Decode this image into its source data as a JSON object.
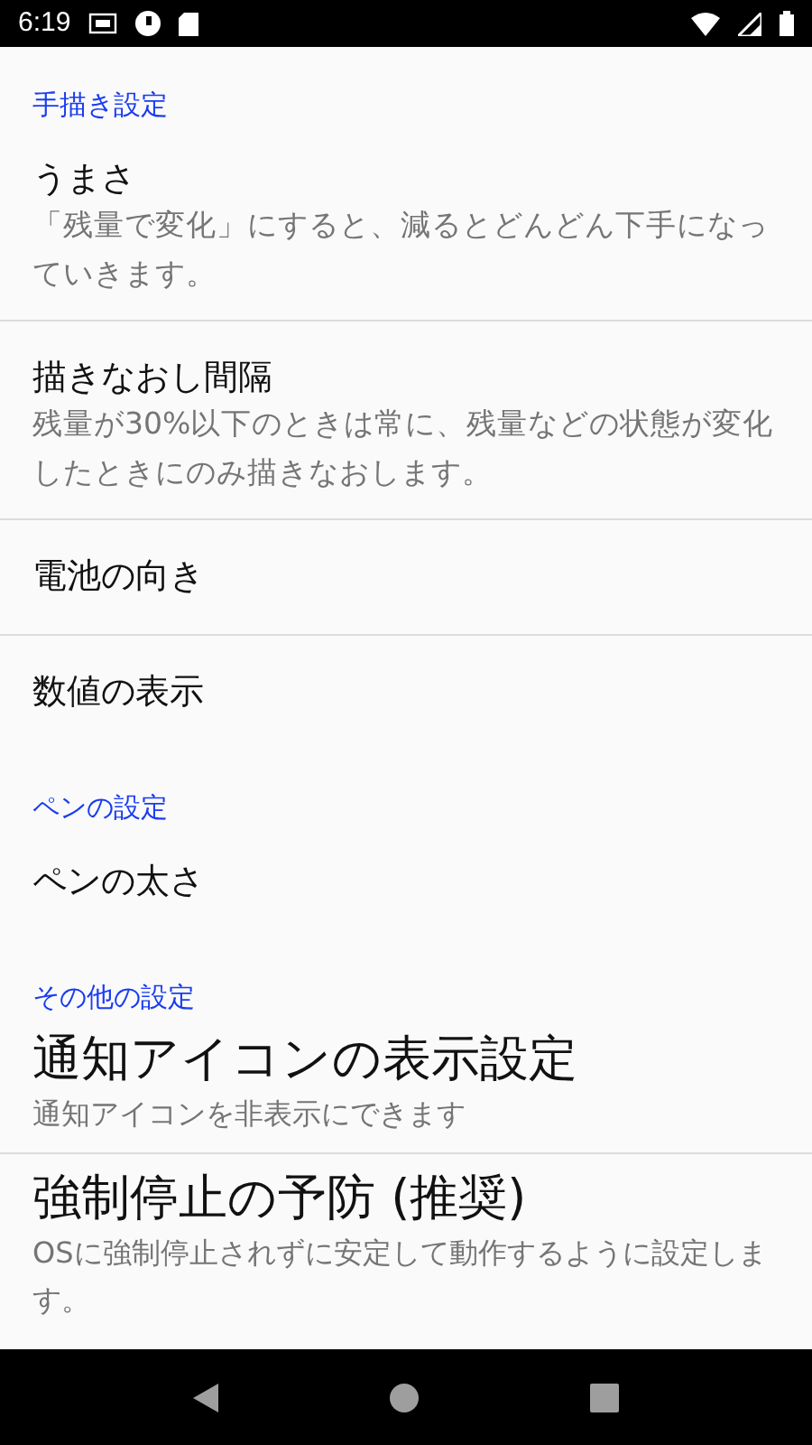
{
  "status_bar": {
    "time": "6:19"
  },
  "sections": [
    {
      "title": "手描き設定",
      "items": [
        {
          "kind": "normal",
          "title": "うまさ",
          "summary": "「残量で変化」にすると、減るとどんどん下手になっていきます。"
        },
        {
          "kind": "normal",
          "title": "描きなおし間隔",
          "summary": "残量が30%以下のときは常に、残量などの状態が変化したときにのみ描きなおします。"
        },
        {
          "kind": "normal",
          "title": "電池の向き"
        },
        {
          "kind": "normal",
          "title": "数値の表示"
        }
      ]
    },
    {
      "title": "ペンの設定",
      "items": [
        {
          "kind": "normal",
          "title": "ペンの太さ"
        }
      ]
    },
    {
      "title": "その他の設定",
      "items": [
        {
          "kind": "large",
          "title": "通知アイコンの表示設定",
          "summary": "通知アイコンを非表示にできます"
        },
        {
          "kind": "large",
          "title": "強制停止の予防 (推奨)",
          "summary": "OSに強制停止されずに安定して動作するように設定します。"
        }
      ]
    }
  ]
}
